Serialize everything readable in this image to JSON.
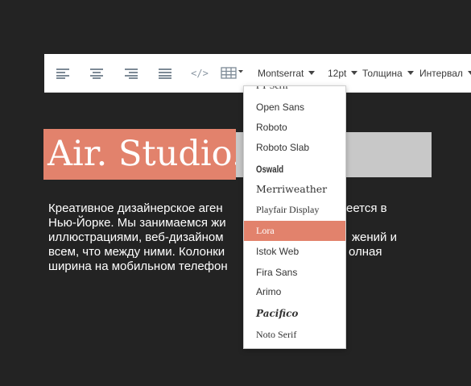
{
  "toolbar": {
    "align_left_icon": "align-left-icon",
    "align_center_icon": "align-center-icon",
    "align_right_icon": "align-right-icon",
    "align_justify_icon": "align-justify-icon",
    "code_label": "</>",
    "table_icon": "table-icon",
    "font_family": "Montserrat",
    "font_size": "12pt",
    "font_weight": "Толщина",
    "spacing": "Интервал"
  },
  "hero": {
    "title": "Air. Studio.",
    "text_lines": [
      "Креативное дизайнерское агентство, находящееся в",
      "Нью-Йорке. Мы занимаемся живописью, иллюстрациями,",
      "иллюстрациями, веб-дизайном, созданием приложений и",
      "всем, что между ними. Колонки заполняют полная",
      "ширина на мобильном телефоне."
    ],
    "visible_lines": [
      [
        "Креативное дизайнерское аген",
        "еется в"
      ],
      [
        "Нью-Йорке. Мы занимаемся жи",
        ""
      ],
      [
        "иллюстрациями, веб-дизайном",
        "жений и"
      ],
      [
        "всем, что между ними. Колонки",
        "олная"
      ],
      [
        "ширина на мобильном телефон",
        ""
      ]
    ]
  },
  "font_dropdown": {
    "partial_top_item": "PT Serif",
    "items": [
      {
        "label": "Open Sans",
        "selected": false
      },
      {
        "label": "Roboto",
        "selected": false
      },
      {
        "label": "Roboto Slab",
        "selected": false
      },
      {
        "label": "Oswald",
        "selected": false
      },
      {
        "label": "Merriweather",
        "selected": false
      },
      {
        "label": "Playfair Display",
        "selected": false
      },
      {
        "label": "Lora",
        "selected": true
      },
      {
        "label": "Istok Web",
        "selected": false
      },
      {
        "label": "Fira Sans",
        "selected": false
      },
      {
        "label": "Arimo",
        "selected": false
      },
      {
        "label": "Pacifico",
        "selected": false
      },
      {
        "label": "Noto Serif",
        "selected": false
      }
    ]
  },
  "colors": {
    "background": "#232323",
    "accent": "#e2826c",
    "toolbar": "#ffffff",
    "hero_bar": "#c8c8c8"
  }
}
